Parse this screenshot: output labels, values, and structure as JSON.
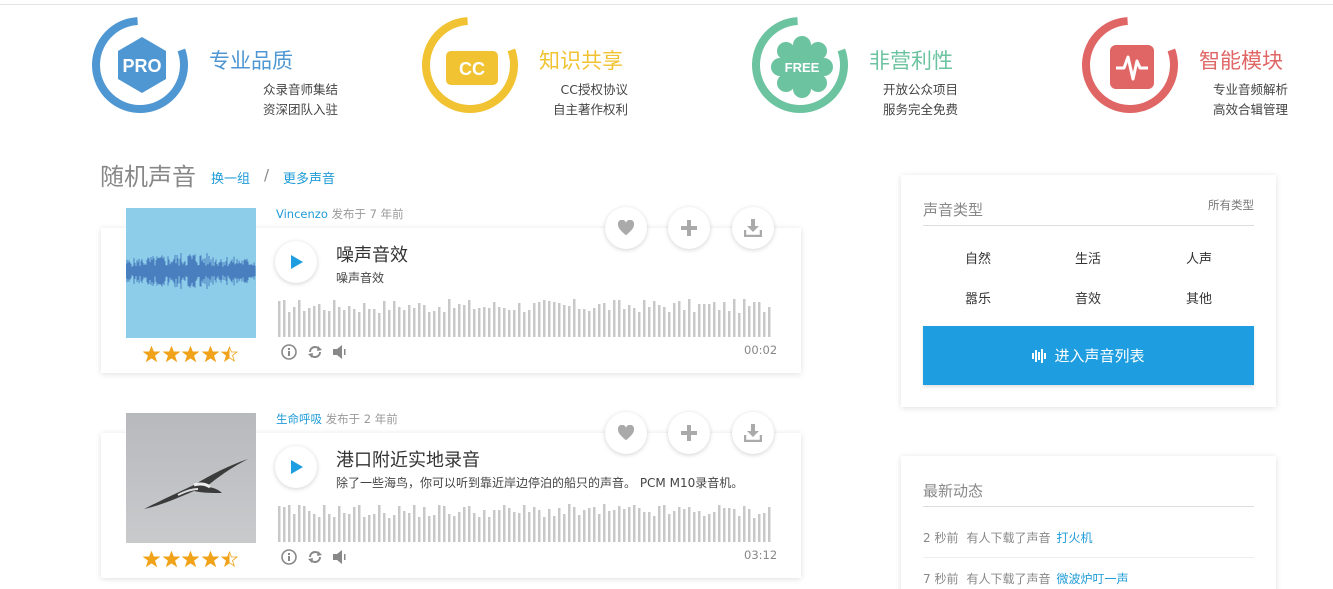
{
  "features": [
    {
      "title": "专业品质",
      "line1": "众录音师集结",
      "line2": "资深团队入驻",
      "badge": "PRO",
      "color": "#4f97d2",
      "icon": "pro-hexagon-icon"
    },
    {
      "title": "知识共享",
      "line1": "CC授权协议",
      "line2": "自主著作权利",
      "badge": "CC",
      "color": "#f1c232",
      "icon": "cc-badge-icon"
    },
    {
      "title": "非营利性",
      "line1": "开放公众项目",
      "line2": "服务完全免费",
      "badge": "FREE",
      "color": "#6cc3a0",
      "icon": "free-flower-icon"
    },
    {
      "title": "智能模块",
      "line1": "专业音频解析",
      "line2": "高效合辑管理",
      "badge": "",
      "color": "#e06565",
      "icon": "waveform-pulse-icon"
    }
  ],
  "section": {
    "title": "随机声音",
    "link_shuffle": "换一组",
    "separator": "/",
    "link_more": "更多声音"
  },
  "sounds": [
    {
      "author": "Vincenzo",
      "posted": "发布于 7 年前",
      "title": "噪声音效",
      "desc": "噪声音效",
      "duration": "00:02",
      "rating": 4.5
    },
    {
      "author": "生命呼吸",
      "posted": "发布于 2 年前",
      "title": "港口附近实地录音",
      "desc": "除了一些海鸟，你可以听到靠近岸边停泊的船只的声音。 PCM M10录音机。",
      "duration": "03:12",
      "rating": 4.5
    }
  ],
  "categories_panel": {
    "title": "声音类型",
    "all_link": "所有类型",
    "items": [
      "自然",
      "生活",
      "人声",
      "嚣乐",
      "音效",
      "其他"
    ],
    "enter_button": "进入声音列表"
  },
  "activity_panel": {
    "title": "最新动态",
    "items": [
      {
        "time": "2 秒前",
        "text": "有人下载了声音",
        "link": "打火机"
      },
      {
        "time": "7 秒前",
        "text": "有人下载了声音",
        "link": "微波炉叮一声"
      }
    ]
  },
  "colors": {
    "accent": "#1e9ee0",
    "link": "#1e9bd7",
    "star": "#f0a31a"
  }
}
